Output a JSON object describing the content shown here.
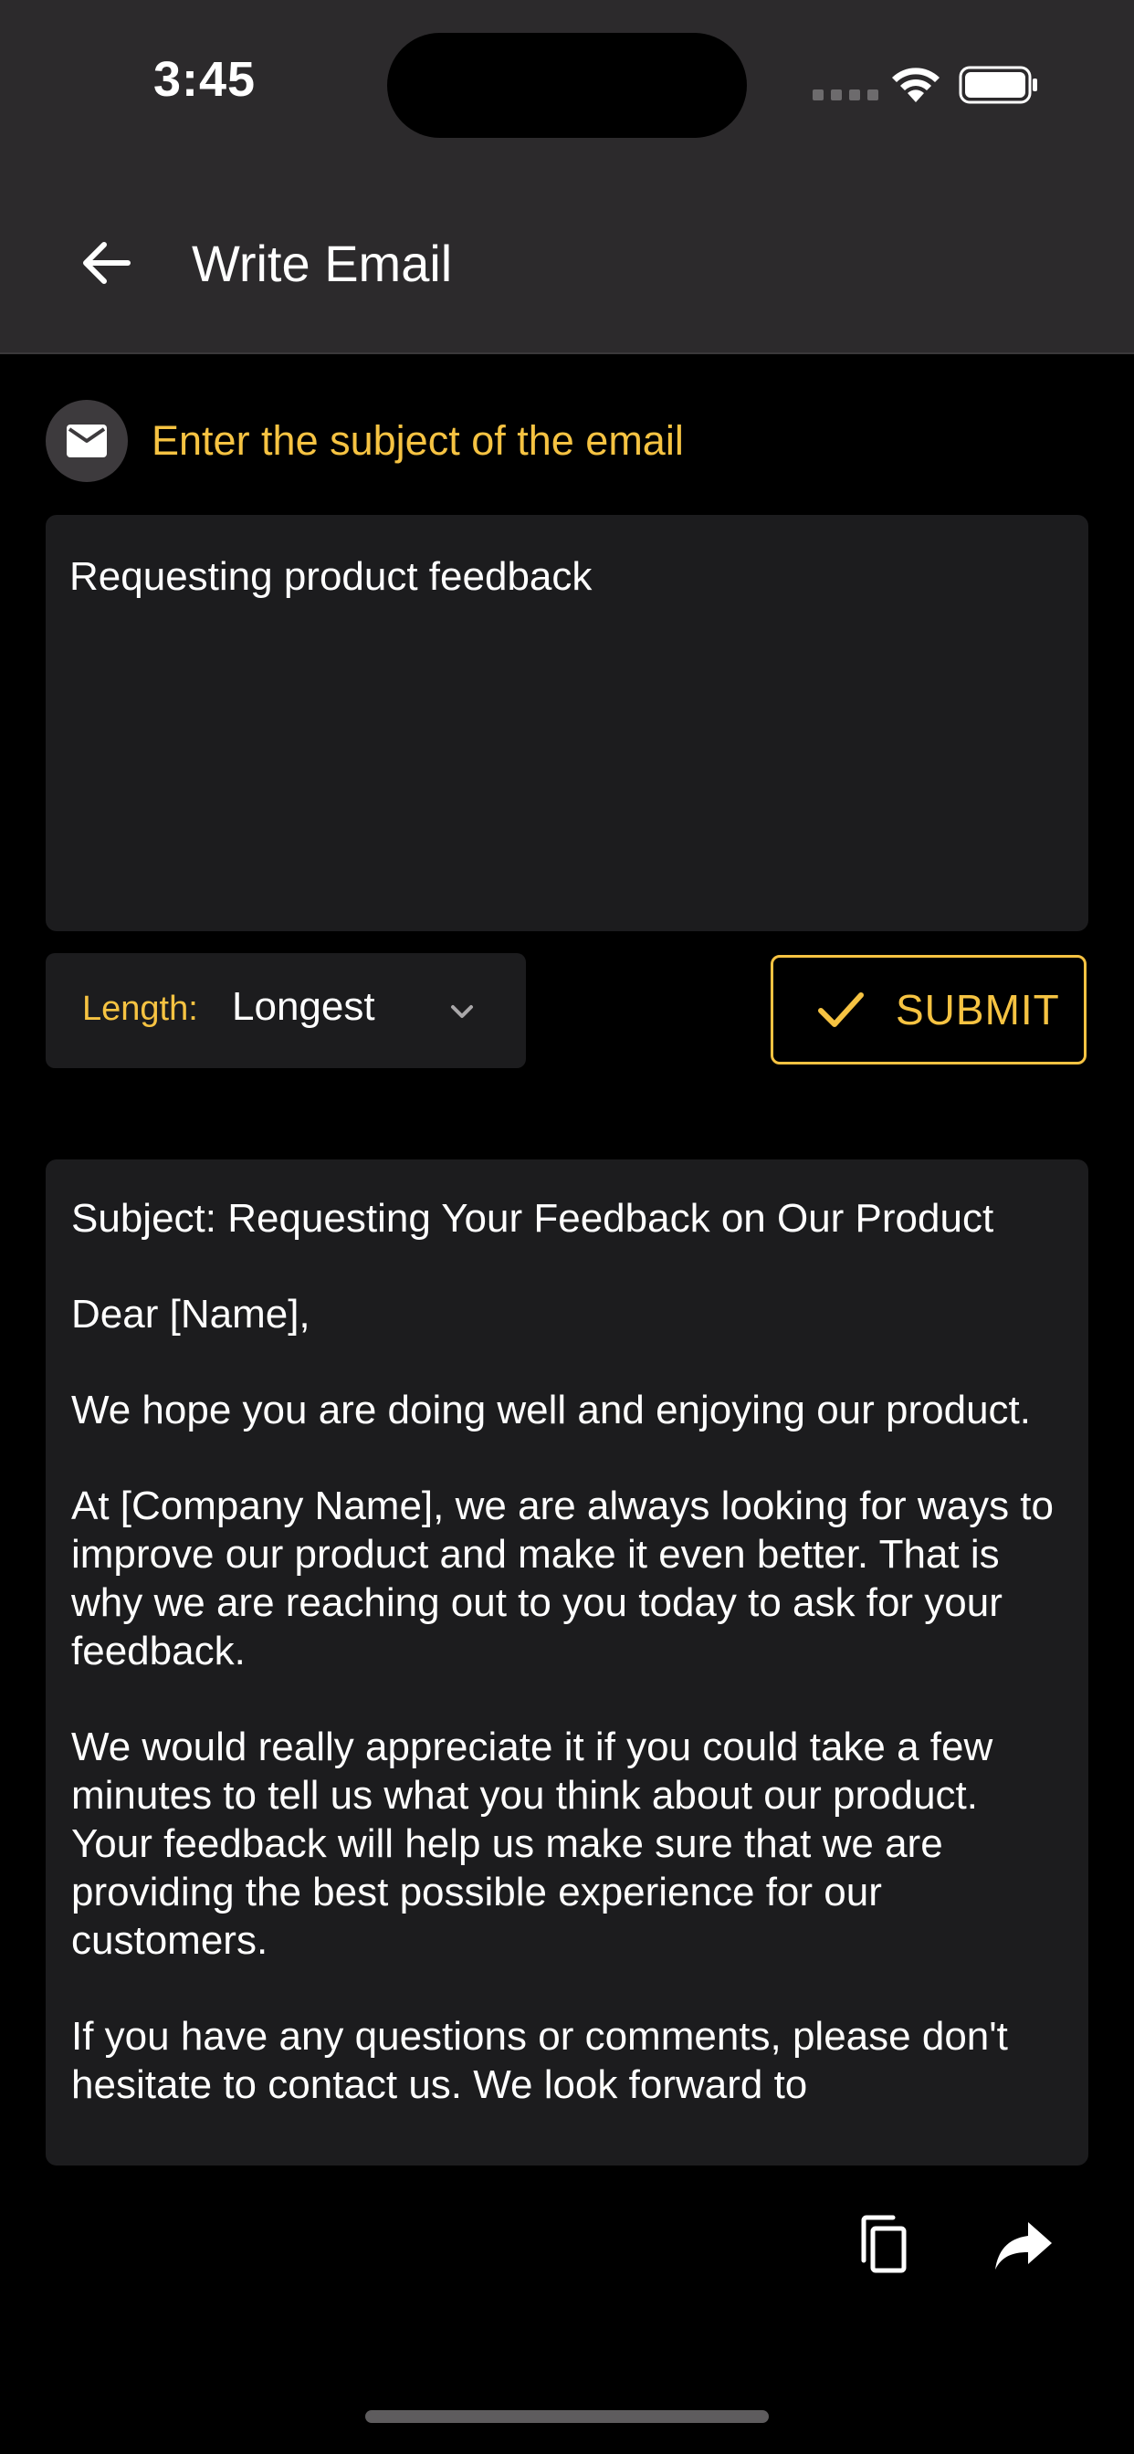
{
  "status_bar": {
    "time": "3:45",
    "icons": [
      "cellular-signal-icon",
      "wifi-icon",
      "battery-icon"
    ]
  },
  "nav": {
    "back_icon": "arrow-left-icon",
    "title": "Write Email"
  },
  "subject": {
    "icon": "envelope-icon",
    "label": "Enter the subject of the email",
    "value": "Requesting product feedback"
  },
  "length": {
    "label": "Length:",
    "selected": "Longest",
    "icon": "chevron-down-icon"
  },
  "submit": {
    "icon": "checkmark-icon",
    "label": "SUBMIT"
  },
  "output": {
    "paragraphs": [
      "Subject: Requesting Your Feedback on Our Product",
      "Dear [Name],",
      "We hope you are doing well and enjoying our product.",
      "At [Company Name], we are always looking for ways to improve our product and make it even better. That is why we are reaching out to you today to ask for your feedback.",
      "We would really appreciate it if you could take a few minutes to tell us what you think about our product. Your feedback will help us make sure that we are providing the best possible experience for our customers.",
      "If you have any questions or comments, please don't hesitate to contact us. We look forward to"
    ]
  },
  "actions": {
    "copy_icon": "copy-icon",
    "share_icon": "share-icon"
  },
  "colors": {
    "background": "#000000",
    "header": "#2c2a2c",
    "surface": "#1c1c1e",
    "accent": "#f6c342",
    "text": "#ffffff"
  }
}
